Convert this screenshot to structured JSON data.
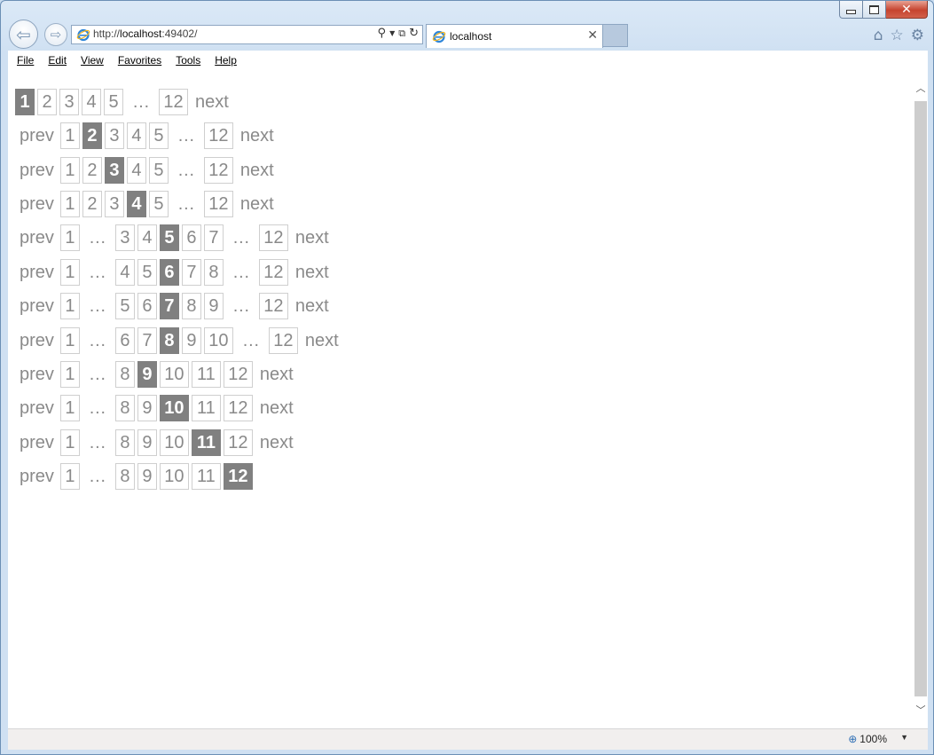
{
  "browser": {
    "url_prefix": "http://",
    "url_host": "localhost",
    "url_suffix": ":49402/",
    "tab_title": "localhost",
    "zoom": "100%"
  },
  "menu": [
    "File",
    "Edit",
    "View",
    "Favorites",
    "Tools",
    "Help"
  ],
  "pager": {
    "prev_label": "prev",
    "next_label": "next",
    "ellipsis": "…",
    "rows": [
      {
        "prev": false,
        "items": [
          "1",
          "2",
          "3",
          "4",
          "5",
          "…",
          "12"
        ],
        "current": "1",
        "next": true
      },
      {
        "prev": true,
        "items": [
          "1",
          "2",
          "3",
          "4",
          "5",
          "…",
          "12"
        ],
        "current": "2",
        "next": true
      },
      {
        "prev": true,
        "items": [
          "1",
          "2",
          "3",
          "4",
          "5",
          "…",
          "12"
        ],
        "current": "3",
        "next": true
      },
      {
        "prev": true,
        "items": [
          "1",
          "2",
          "3",
          "4",
          "5",
          "…",
          "12"
        ],
        "current": "4",
        "next": true
      },
      {
        "prev": true,
        "items": [
          "1",
          "…",
          "3",
          "4",
          "5",
          "6",
          "7",
          "…",
          "12"
        ],
        "current": "5",
        "next": true
      },
      {
        "prev": true,
        "items": [
          "1",
          "…",
          "4",
          "5",
          "6",
          "7",
          "8",
          "…",
          "12"
        ],
        "current": "6",
        "next": true
      },
      {
        "prev": true,
        "items": [
          "1",
          "…",
          "5",
          "6",
          "7",
          "8",
          "9",
          "…",
          "12"
        ],
        "current": "7",
        "next": true
      },
      {
        "prev": true,
        "items": [
          "1",
          "…",
          "6",
          "7",
          "8",
          "9",
          "10",
          "…",
          "12"
        ],
        "current": "8",
        "next": true
      },
      {
        "prev": true,
        "items": [
          "1",
          "…",
          "8",
          "9",
          "10",
          "11",
          "12"
        ],
        "current": "9",
        "next": true
      },
      {
        "prev": true,
        "items": [
          "1",
          "…",
          "8",
          "9",
          "10",
          "11",
          "12"
        ],
        "current": "10",
        "next": true
      },
      {
        "prev": true,
        "items": [
          "1",
          "…",
          "8",
          "9",
          "10",
          "11",
          "12"
        ],
        "current": "11",
        "next": true
      },
      {
        "prev": true,
        "items": [
          "1",
          "…",
          "8",
          "9",
          "10",
          "11",
          "12"
        ],
        "current": "12",
        "next": false
      }
    ]
  }
}
